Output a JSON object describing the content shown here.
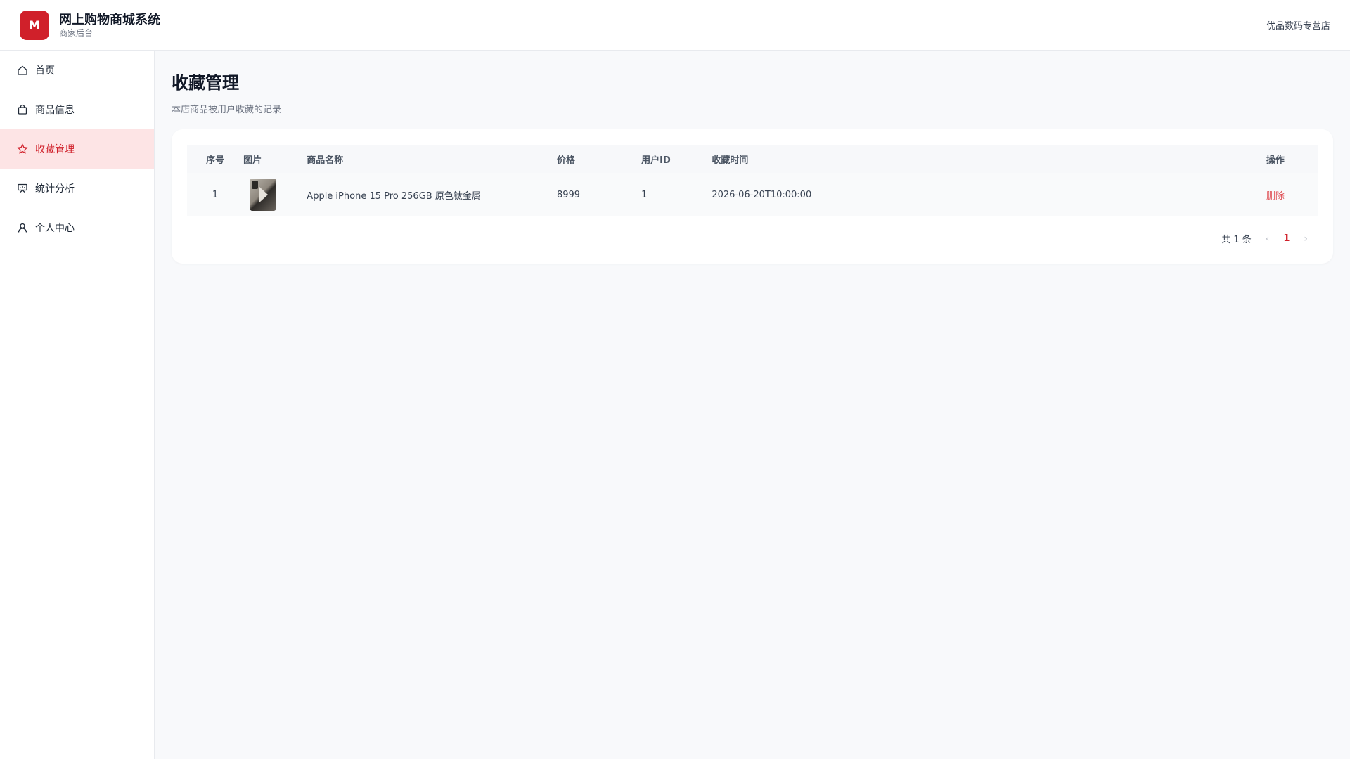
{
  "header": {
    "logo_letter": "M",
    "title": "网上购物商城系统",
    "subtitle": "商家后台",
    "shop_name": "优品数码专营店"
  },
  "sidebar": {
    "items": [
      {
        "label": "首页",
        "icon": "home-icon",
        "active": false
      },
      {
        "label": "商品信息",
        "icon": "shopping-bag-icon",
        "active": false
      },
      {
        "label": "收藏管理",
        "icon": "star-icon",
        "active": true
      },
      {
        "label": "统计分析",
        "icon": "chart-board-icon",
        "active": false
      },
      {
        "label": "个人中心",
        "icon": "user-icon",
        "active": false
      }
    ]
  },
  "main": {
    "title": "收藏管理",
    "description": "本店商品被用户收藏的记录",
    "table": {
      "headers": [
        "序号",
        "图片",
        "商品名称",
        "价格",
        "用户ID",
        "收藏时间",
        "操作"
      ],
      "rows": [
        {
          "index": "1",
          "image": "iphone-product-image",
          "name": "Apple iPhone 15 Pro 256GB 原色钛金属",
          "price": "8999",
          "user_id": "1",
          "time": "2026-06-20T10:00:00",
          "action": "删除"
        }
      ]
    },
    "pagination": {
      "total_text": "共 1 条",
      "current_page": "1"
    }
  },
  "colors": {
    "accent": "#d0202a",
    "active_bg": "#fde4e5",
    "delete": "#e05258"
  }
}
